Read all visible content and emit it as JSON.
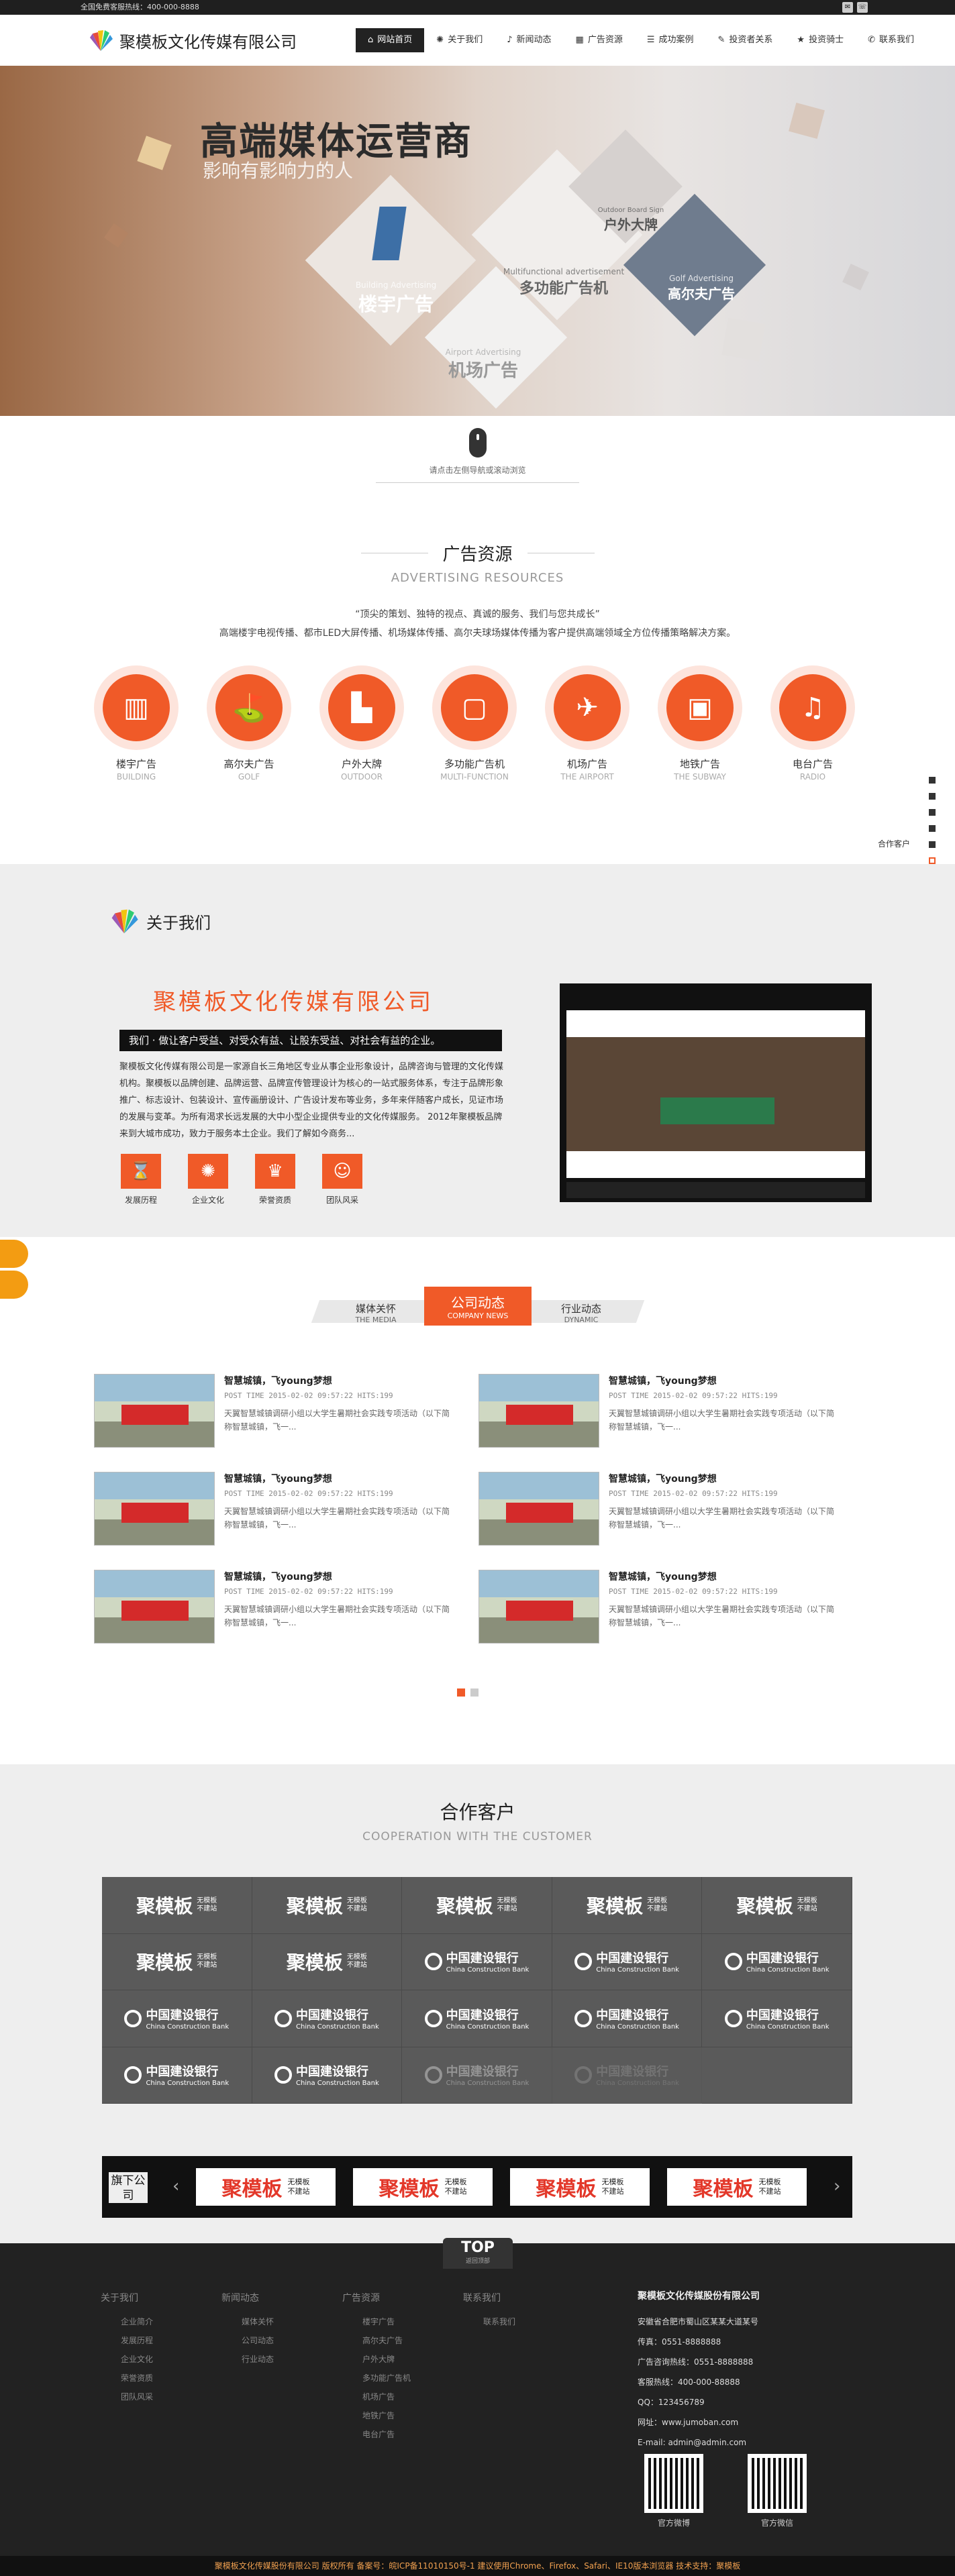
{
  "topbar": {
    "hotline": "全国免费客服热线：400-000-8888"
  },
  "header": {
    "logo_text": "聚模板文化传媒有限公司"
  },
  "nav": [
    {
      "label": "网站首页",
      "icon": "home-icon"
    },
    {
      "label": "关于我们",
      "icon": "sun-icon"
    },
    {
      "label": "新闻动态",
      "icon": "bell-icon"
    },
    {
      "label": "广告资源",
      "icon": "grid-icon"
    },
    {
      "label": "成功案例",
      "icon": "list-icon"
    },
    {
      "label": "投资者关系",
      "icon": "chat-icon"
    },
    {
      "label": "投资骑士",
      "icon": "star-icon"
    },
    {
      "label": "联系我们",
      "icon": "phone-icon"
    }
  ],
  "banner": {
    "title": "高端媒体运营商",
    "subtitle": "影响有影响力的人",
    "diamonds": [
      {
        "en": "Building Advertising",
        "cn": "楼宇广告"
      },
      {
        "en": "Multifunctional advertisement",
        "cn": "多功能广告机"
      },
      {
        "en": "Outdoor Board Sign",
        "cn": "户外大牌"
      },
      {
        "en": "Golf Advertising",
        "cn": "高尔夫广告"
      },
      {
        "en": "Airport Advertising",
        "cn": "机场广告"
      }
    ]
  },
  "scroll_hint": "请点击左侧导航或滚动浏览",
  "ad_section": {
    "title": "广告资源",
    "title_en": "ADVERTISING RESOURCES",
    "line1": "“顶尖的策划、独特的视点、真诚的服务、我们与您共成长”",
    "line2": "高端楼宇电视传播、都市LED大屏传播、机场媒体传播、高尔夫球场媒体传播为客户提供高端领域全方位传播策略解决方案。",
    "items": [
      {
        "cn": "楼宇广告",
        "en": "BUILDING",
        "icon": "building-icon"
      },
      {
        "cn": "高尔夫广告",
        "en": "GOLF",
        "icon": "golf-icon"
      },
      {
        "cn": "户外大牌",
        "en": "OUTDOOR",
        "icon": "tower-icon"
      },
      {
        "cn": "多功能广告机",
        "en": "MULTI-FUNCTION",
        "icon": "kiosk-icon"
      },
      {
        "cn": "机场广告",
        "en": "THE AIRPORT",
        "icon": "plane-icon"
      },
      {
        "cn": "地铁广告",
        "en": "THE SUBWAY",
        "icon": "train-icon"
      },
      {
        "cn": "电台广告",
        "en": "RADIO",
        "icon": "radio-icon"
      }
    ]
  },
  "side_label": "合作客户",
  "about": {
    "title": "关于我们",
    "company": "聚模板文化传媒有限公司",
    "slogan": "我们 · 做让客户受益、对受众有益、让股东受益、对社会有益的企业。",
    "text": "聚模板文化传媒有限公司是一家源自长三角地区专业从事企业形象设计，品牌咨询与管理的文化传媒机构。聚模板以品牌创建、品牌运营、品牌宣传管理设计为核心的一站式服务体系，专注于品牌形象推广、标志设计、包装设计、宣传画册设计、广告设计发布等业务，多年来伴随客户成长，见证市场的发展与变革。为所有渴求长远发展的大中小型企业提供专业的文化传媒服务。 2012年聚模板品牌来到大城市成功，致力于服务本土企业。我们了解如今商务...",
    "icons": [
      {
        "label": "发展历程",
        "icon": "hourglass-icon"
      },
      {
        "label": "企业文化",
        "icon": "swirl-icon"
      },
      {
        "label": "荣誉资质",
        "icon": "trophy-icon"
      },
      {
        "label": "团队风采",
        "icon": "team-icon"
      }
    ]
  },
  "news": {
    "tabs": [
      {
        "cn": "媒体关怀",
        "en": "THE MEDIA"
      },
      {
        "cn": "公司动态",
        "en": "COMPANY NEWS"
      },
      {
        "cn": "行业动态",
        "en": "DYNAMIC"
      }
    ],
    "items": [
      {
        "title": "智慧城镇，飞young梦想",
        "date": "POST TIME 2015-02-02 09:57:22 HITS:199",
        "desc": "天翼智慧城镇调研小组以大学生暑期社会实践专项活动（以下简称智慧城镇，飞一..."
      },
      {
        "title": "智慧城镇，飞young梦想",
        "date": "POST TIME 2015-02-02 09:57:22 HITS:199",
        "desc": "天翼智慧城镇调研小组以大学生暑期社会实践专项活动（以下简称智慧城镇，飞一..."
      },
      {
        "title": "智慧城镇，飞young梦想",
        "date": "POST TIME 2015-02-02 09:57:22 HITS:199",
        "desc": "天翼智慧城镇调研小组以大学生暑期社会实践专项活动（以下简称智慧城镇，飞一..."
      },
      {
        "title": "智慧城镇，飞young梦想",
        "date": "POST TIME 2015-02-02 09:57:22 HITS:199",
        "desc": "天翼智慧城镇调研小组以大学生暑期社会实践专项活动（以下简称智慧城镇，飞一..."
      },
      {
        "title": "智慧城镇，飞young梦想",
        "date": "POST TIME 2015-02-02 09:57:22 HITS:199",
        "desc": "天翼智慧城镇调研小组以大学生暑期社会实践专项活动（以下简称智慧城镇，飞一..."
      },
      {
        "title": "智慧城镇，飞young梦想",
        "date": "POST TIME 2015-02-02 09:57:22 HITS:199",
        "desc": "天翼智慧城镇调研小组以大学生暑期社会实践专项活动（以下简称智慧城镇，飞一..."
      }
    ]
  },
  "coop": {
    "title": "合作客户",
    "title_en": "COOPERATION WITH THE CUSTOMER",
    "logo_big": "聚模板",
    "logo_small1": "无模板",
    "logo_small2": "不建站",
    "bank_cn": "中国建设银行",
    "bank_en": "China Construction Bank"
  },
  "flagship": {
    "label": "旗下公司"
  },
  "footer": {
    "top": "TOP",
    "top_sub": "返回顶部",
    "cols": [
      {
        "head": "关于我们",
        "links": [
          "企业简介",
          "发展历程",
          "企业文化",
          "荣誉资质",
          "团队风采"
        ]
      },
      {
        "head": "新闻动态",
        "links": [
          "媒体关怀",
          "公司动态",
          "行业动态"
        ]
      },
      {
        "head": "广告资源",
        "links": [
          "楼宇广告",
          "高尔夫广告",
          "户外大牌",
          "多功能广告机",
          "机场广告",
          "地铁广告",
          "电台广告"
        ]
      },
      {
        "head": "联系我们",
        "links": [
          "联系我们"
        ]
      }
    ],
    "company": "聚模板文化传媒股份有限公司",
    "address": "安徽省合肥市蜀山区某某大道某号",
    "fax": "传真：0551-8888888",
    "ad_tel": "广告咨询热线：0551-8888888",
    "service": "客服热线：400-000-88888",
    "qq": "QQ：123456789",
    "web": "网址：www.jumoban.com",
    "email": "E-mail: admin@admin.com",
    "qr1": "官方微博",
    "qr2": "官方微信"
  },
  "copyright": "聚模板文化传媒股份有限公司  版权所有  备案号：皖ICP备11010150号-1  建议使用Chrome、Firefox、Safari、IE10版本浏览器  技术支持：聚模板"
}
